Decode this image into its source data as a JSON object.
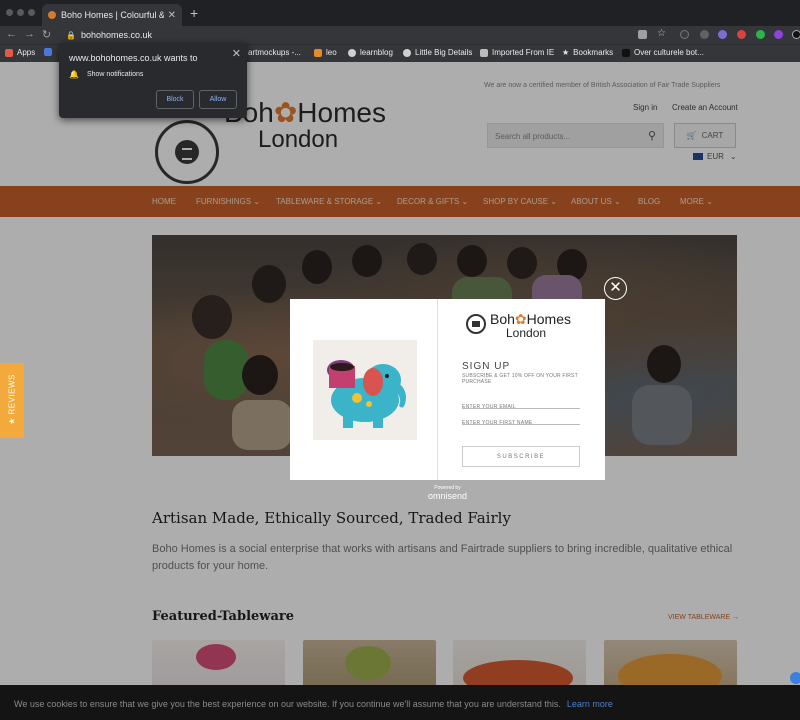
{
  "browser": {
    "tab_title": "Boho Homes | Colourful & che",
    "url": "bohohomes.co.uk",
    "bookmarks": [
      "Apps",
      "artmockups -...",
      "leo",
      "learnblog",
      "Little Big Details",
      "Imported From IE",
      "Bookmarks",
      "Over culturele bot..."
    ]
  },
  "notification_popup": {
    "site": "www.bohohomes.co.uk wants to",
    "request": "Show notifications",
    "block_label": "Block",
    "allow_label": "Allow"
  },
  "header": {
    "member_text": "We are now a certified member of British Association of Fair Trade Suppliers",
    "signin": "Sign in",
    "create_account": "Create an Account",
    "search_placeholder": "Search all products...",
    "cart_label": "CART",
    "currency": "EUR",
    "logo_line1_a": "Boh",
    "logo_line1_b": "Homes",
    "logo_line2": "London"
  },
  "nav": [
    "HOME",
    "FURNISHINGS ⌄",
    "TABLEWARE & STORAGE ⌄",
    "DECOR & GIFTS ⌄",
    "SHOP BY CAUSE ⌄",
    "ABOUT US ⌄",
    "BLOG",
    "MORE ⌄"
  ],
  "content": {
    "heading": "Artisan Made, Ethically Sourced, Traded Fairly",
    "paragraph": "Boho Homes is a social enterprise that works with artisans and Fairtrade suppliers to bring incredible, qualitative ethical products for your home.",
    "featured_title": "Featured-Tableware",
    "view_link": "VIEW TABLEWARE →"
  },
  "reviews_tab": "★ REVIEWS",
  "modal": {
    "logo_line1_a": "Boh",
    "logo_line1_b": "Homes",
    "logo_line2": "London",
    "title": "SIGN UP",
    "subtitle": "SUBSCRIBE & GET 10% OFF ON YOUR FIRST PURCHASE",
    "email_placeholder": "ENTER YOUR EMAIL",
    "name_placeholder": "ENTER YOUR FIRST NAME",
    "subscribe_label": "SUBSCRIBE",
    "powered_by": "Powered by",
    "powered_brand": "omnisend"
  },
  "cookie": {
    "text": "We use cookies to ensure that we give you the best experience on our website. If you continue we'll assume that you are understand this.",
    "more": "Learn more"
  },
  "icons": {
    "lock": "lock-icon",
    "search": "search-icon",
    "cart": "cart-icon",
    "close": "close-icon",
    "bell": "bell-icon"
  },
  "colors": {
    "brand_orange": "#c7622b",
    "reviews_tab": "#f4a93c",
    "browser_dark": "#202124",
    "link_blue": "#8ab4f8"
  }
}
